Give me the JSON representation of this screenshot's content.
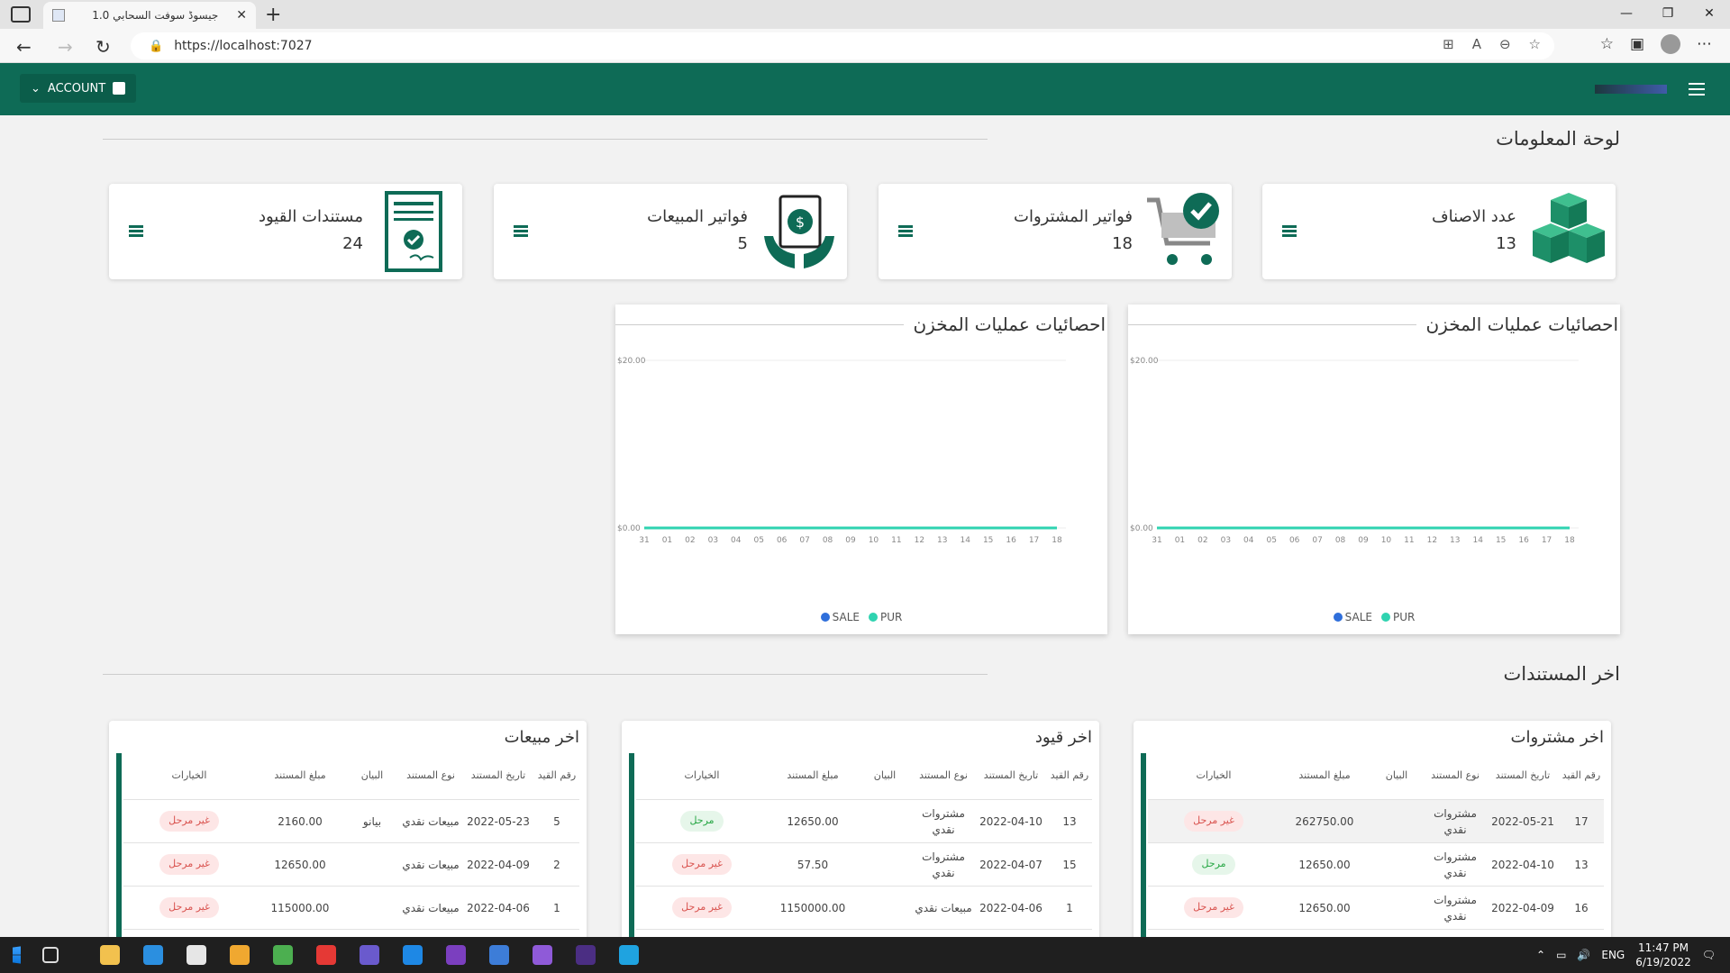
{
  "browser": {
    "tab_title": "جيسوڈ سوفت السحابي 1.0",
    "tab_close": "✕",
    "new_tab": "+",
    "url": "https://localhost:7027",
    "window_controls": [
      "—",
      "❐",
      "✕"
    ]
  },
  "navbar": {
    "account_label": "ACCOUNT"
  },
  "dashboard": {
    "title": "لوحة المعلومات",
    "stats": [
      {
        "label": "عدد الاصناف",
        "value": "13",
        "icon": "cubes-icon"
      },
      {
        "label": "فواتير المشتروات",
        "value": "18",
        "icon": "cart-check-icon"
      },
      {
        "label": "فواتير المبيعات",
        "value": "5",
        "icon": "money-hands-icon"
      },
      {
        "label": "مستندات القيود",
        "value": "24",
        "icon": "certificate-icon"
      }
    ]
  },
  "charts_section": {
    "title_left": "احصائيات عمليات المخزن",
    "title_right": "احصائيات عمليات المخزن",
    "legend_sale": "SALE",
    "legend_pur": "PUR",
    "colors": {
      "sale": "#2f6fdb",
      "pur": "#2fd3b0"
    }
  },
  "chart_data": [
    {
      "type": "line",
      "title": "احصائيات عمليات المخزن",
      "x": [
        "31",
        "01",
        "02",
        "03",
        "04",
        "05",
        "06",
        "07",
        "08",
        "09",
        "10",
        "11",
        "12",
        "13",
        "14",
        "15",
        "16",
        "17",
        "18"
      ],
      "y_ticks": [
        "$0.00",
        "$20.00"
      ],
      "ylim": [
        0,
        20
      ],
      "series": [
        {
          "name": "SALE",
          "values": [
            0,
            0,
            0,
            0,
            0,
            0,
            0,
            0,
            0,
            0,
            0,
            0,
            0,
            0,
            0,
            0,
            0,
            0,
            0
          ]
        },
        {
          "name": "PUR",
          "values": [
            0,
            0,
            0,
            0,
            0,
            0,
            0,
            0,
            0,
            0,
            0,
            0,
            0,
            0,
            0,
            0,
            0,
            0,
            0
          ]
        }
      ]
    },
    {
      "type": "line",
      "title": "احصائيات عمليات المخزن",
      "x": [
        "31",
        "01",
        "02",
        "03",
        "04",
        "05",
        "06",
        "07",
        "08",
        "09",
        "10",
        "11",
        "12",
        "13",
        "14",
        "15",
        "16",
        "17",
        "18"
      ],
      "y_ticks": [
        "$0.00",
        "$20.00"
      ],
      "ylim": [
        0,
        20
      ],
      "series": [
        {
          "name": "SALE",
          "values": [
            0,
            0,
            0,
            0,
            0,
            0,
            0,
            0,
            0,
            0,
            0,
            0,
            0,
            0,
            0,
            0,
            0,
            0,
            0
          ]
        },
        {
          "name": "PUR",
          "values": [
            0,
            0,
            0,
            0,
            0,
            0,
            0,
            0,
            0,
            0,
            0,
            0,
            0,
            0,
            0,
            0,
            0,
            0,
            0
          ]
        }
      ]
    }
  ],
  "documents": {
    "title": "اخر المستندات",
    "headers": [
      "رقم القيد",
      "تاريخ المستند",
      "نوع المستند",
      "البيان",
      "مبلغ المستند",
      "الخيارات"
    ],
    "tables": [
      {
        "title": "اخر مشتروات",
        "rows": [
          {
            "id": "17",
            "date": "2022-05-21",
            "type": "مشتروات نقدي",
            "desc": "",
            "amount": "262750.00",
            "status": "غير مرحل",
            "posted": false
          },
          {
            "id": "13",
            "date": "2022-04-10",
            "type": "مشتروات نقدي",
            "desc": "",
            "amount": "12650.00",
            "status": "مرحل",
            "posted": true
          },
          {
            "id": "16",
            "date": "2022-04-09",
            "type": "مشتروات نقدي",
            "desc": "",
            "amount": "12650.00",
            "status": "غير مرحل",
            "posted": false
          }
        ]
      },
      {
        "title": "اخر قيود",
        "rows": [
          {
            "id": "13",
            "date": "2022-04-10",
            "type": "مشتروات نقدي",
            "desc": "",
            "amount": "12650.00",
            "status": "مرحل",
            "posted": true
          },
          {
            "id": "15",
            "date": "2022-04-07",
            "type": "مشتروات نقدي",
            "desc": "",
            "amount": "57.50",
            "status": "غير مرحل",
            "posted": false
          },
          {
            "id": "1",
            "date": "2022-04-06",
            "type": "مبيعات نقدي",
            "desc": "",
            "amount": "1150000.00",
            "status": "غير مرحل",
            "posted": false
          }
        ]
      },
      {
        "title": "اخر مبيعات",
        "rows": [
          {
            "id": "5",
            "date": "2022-05-23",
            "type": "مبيعات نقدي",
            "desc": "بيانو",
            "amount": "2160.00",
            "status": "غير مرحل",
            "posted": false
          },
          {
            "id": "2",
            "date": "2022-04-09",
            "type": "مبيعات نقدي",
            "desc": "",
            "amount": "12650.00",
            "status": "غير مرحل",
            "posted": false
          },
          {
            "id": "1",
            "date": "2022-04-06",
            "type": "مبيعات نقدي",
            "desc": "",
            "amount": "115000.00",
            "status": "غير مرحل",
            "posted": false
          }
        ]
      }
    ]
  },
  "taskbar": {
    "lang": "ENG",
    "time": "11:47 PM",
    "date": "6/19/2022",
    "apps": [
      "file-explorer-icon",
      "vscode-icon",
      "editor-icon",
      "notepad-icon",
      "chrome-icon",
      "xampp-icon",
      "app-icon",
      "edge-icon",
      "sublime-icon",
      "app14-icon",
      "visual-studio-icon",
      "terminal-icon",
      "edge-dev-icon"
    ],
    "app_colors": [
      "#f2c14e",
      "#2b8fe0",
      "#e6e6e6",
      "#f0a830",
      "#4caf50",
      "#e53935",
      "#6a5acd",
      "#1e88e5",
      "#7b3fbf",
      "#3d7dd8",
      "#8f5ad8",
      "#4b2e83",
      "#1fa3e0"
    ]
  }
}
